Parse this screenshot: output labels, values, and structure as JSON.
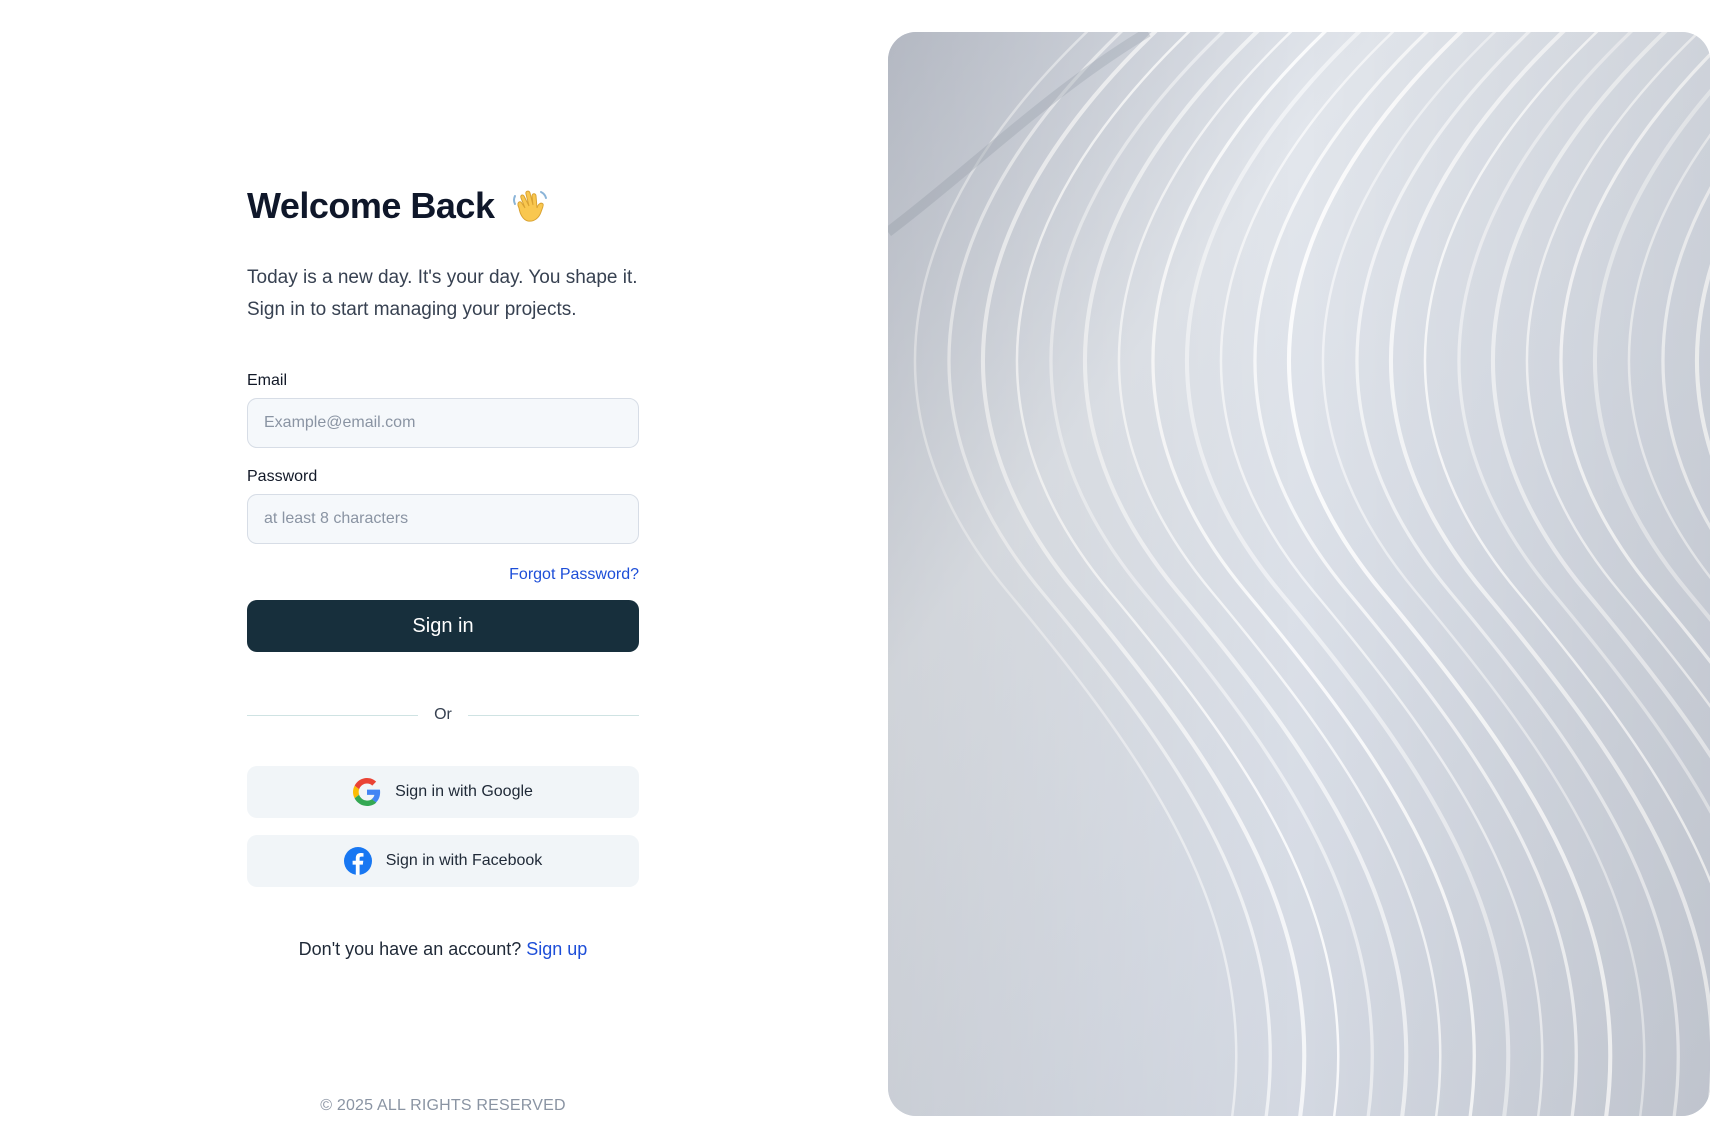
{
  "welcome": {
    "title": "Welcome Back",
    "subtitle_line1": "Today is a new day. It's your day. You shape it.",
    "subtitle_line2": "Sign in to start managing your projects."
  },
  "form": {
    "email_label": "Email",
    "email_placeholder": "Example@email.com",
    "email_value": "",
    "password_label": "Password",
    "password_placeholder": "at least 8 characters",
    "password_value": "",
    "forgot_password": "Forgot Password?",
    "signin_label": "Sign in"
  },
  "divider": {
    "text": "Or"
  },
  "social": {
    "google_label": "Sign in with Google",
    "facebook_label": "Sign in with Facebook"
  },
  "signup": {
    "prompt": "Don't you have an account? ",
    "link": "Sign up"
  },
  "footer": {
    "copyright": "© 2025 ALL RIGHTS RESERVED"
  },
  "icons": {
    "title_icon": "waving-hand-icon",
    "google_icon": "google-icon",
    "facebook_icon": "facebook-icon"
  },
  "colors": {
    "primary_button": "#172f3c",
    "link": "#1d4ed8",
    "input_bg": "#f5f8fb",
    "social_bg": "#f1f5f8"
  }
}
